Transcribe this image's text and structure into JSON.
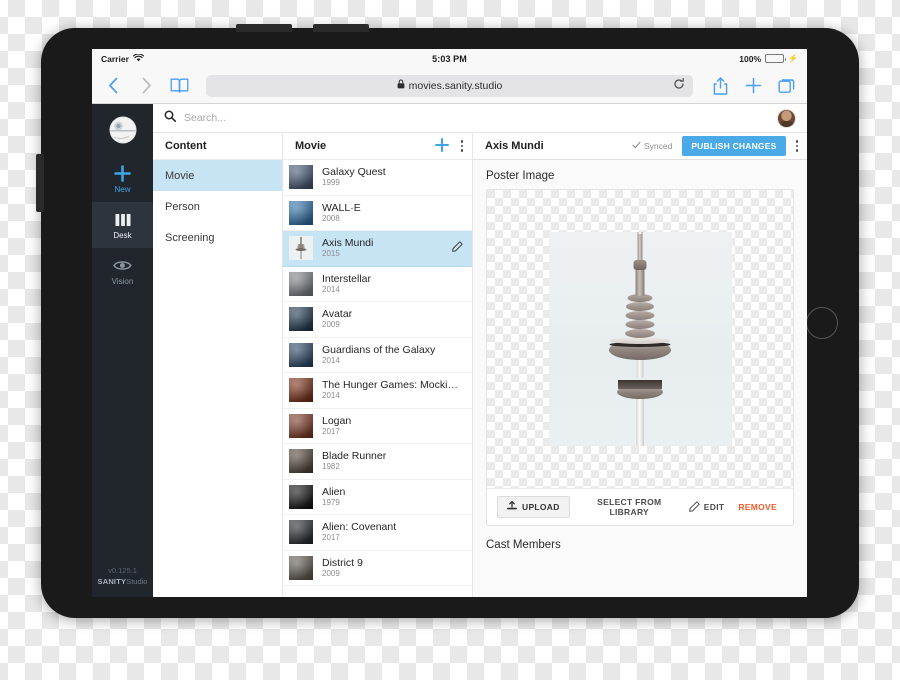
{
  "status_bar": {
    "carrier": "Carrier",
    "wifi_icon": "wifi-icon",
    "time": "5:03 PM",
    "battery_percent": "100%",
    "battery_icon": "battery-full-icon",
    "charging_icon": "lightning-bolt-icon"
  },
  "browser": {
    "back_icon": "chevron-left-icon",
    "forward_icon": "chevron-right-icon",
    "bookmarks_icon": "book-icon",
    "lock_icon": "lock-icon",
    "url": "movies.sanity.studio",
    "reload_icon": "reload-icon",
    "share_icon": "share-icon",
    "new_tab_icon": "plus-icon",
    "tabs_icon": "tabs-icon"
  },
  "studio_nav": {
    "logo_icon": "death-star-logo-icon",
    "items": [
      {
        "label": "New",
        "icon": "plus-icon"
      },
      {
        "label": "Desk",
        "icon": "columns-icon"
      },
      {
        "label": "Vision",
        "icon": "eye-icon"
      }
    ],
    "version": "v0.125.1",
    "brand_bold": "SANITY",
    "brand_light": "Studio"
  },
  "search": {
    "icon": "search-icon",
    "placeholder": "Search...",
    "value": ""
  },
  "avatar": {
    "name": "user-avatar"
  },
  "content_pane": {
    "header": "Content",
    "items": [
      {
        "label": "Movie",
        "selected": true
      },
      {
        "label": "Person",
        "selected": false
      },
      {
        "label": "Screening",
        "selected": false
      }
    ]
  },
  "movie_pane": {
    "header": "Movie",
    "add_icon": "plus-icon",
    "menu_icon": "kebab-menu-icon",
    "edit_icon": "pencil-icon",
    "items": [
      {
        "title": "Galaxy Quest",
        "year": "1999",
        "selected": false,
        "thumb": "#4a5f86"
      },
      {
        "title": "WALL·E",
        "year": "2008",
        "selected": false,
        "thumb": "#2f7fc4"
      },
      {
        "title": "Axis Mundi",
        "year": "2015",
        "selected": true,
        "thumb": "#e9edee"
      },
      {
        "title": "Interstellar",
        "year": "2014",
        "selected": false,
        "thumb": "#8d949c"
      },
      {
        "title": "Avatar",
        "year": "2009",
        "selected": false,
        "thumb": "#1f3a55"
      },
      {
        "title": "Guardians of the Galaxy",
        "year": "2014",
        "selected": false,
        "thumb": "#2a4a74"
      },
      {
        "title": "The Hunger Games: Mockin…",
        "year": "2014",
        "selected": false,
        "thumb": "#8c2f13"
      },
      {
        "title": "Logan",
        "year": "2017",
        "selected": false,
        "thumb": "#8f3b22"
      },
      {
        "title": "Blade Runner",
        "year": "1982",
        "selected": false,
        "thumb": "#5a4a3c"
      },
      {
        "title": "Alien",
        "year": "1979",
        "selected": false,
        "thumb": "#0a0a0a"
      },
      {
        "title": "Alien: Covenant",
        "year": "2017",
        "selected": false,
        "thumb": "#232a2c"
      },
      {
        "title": "District 9",
        "year": "2009",
        "selected": false,
        "thumb": "#6b645a"
      }
    ]
  },
  "document": {
    "title": "Axis Mundi",
    "sync_status": "Synced",
    "sync_icon": "check-icon",
    "publish_label": "PUBLISH CHANGES",
    "menu_icon": "kebab-menu-icon",
    "poster_label": "Poster Image",
    "poster_alt": "tv-tower-photo",
    "actions": {
      "upload_label": "UPLOAD",
      "upload_icon": "upload-icon",
      "select_from_library_label": "SELECT FROM LIBRARY",
      "edit_label": "EDIT",
      "edit_icon": "pencil-icon",
      "remove_label": "REMOVE"
    },
    "cast_members_label": "Cast Members"
  },
  "device": {
    "home_button": "home-button",
    "power_button": "power-button",
    "volume_up": "volume-up-button",
    "volume_down": "volume-down-button"
  },
  "colors": {
    "accent_blue": "#4aaae8",
    "nav_dark": "#21262c",
    "selection_blue": "#c7e4f5",
    "remove_orange": "#f05a28",
    "battery_green": "#4cd964"
  }
}
